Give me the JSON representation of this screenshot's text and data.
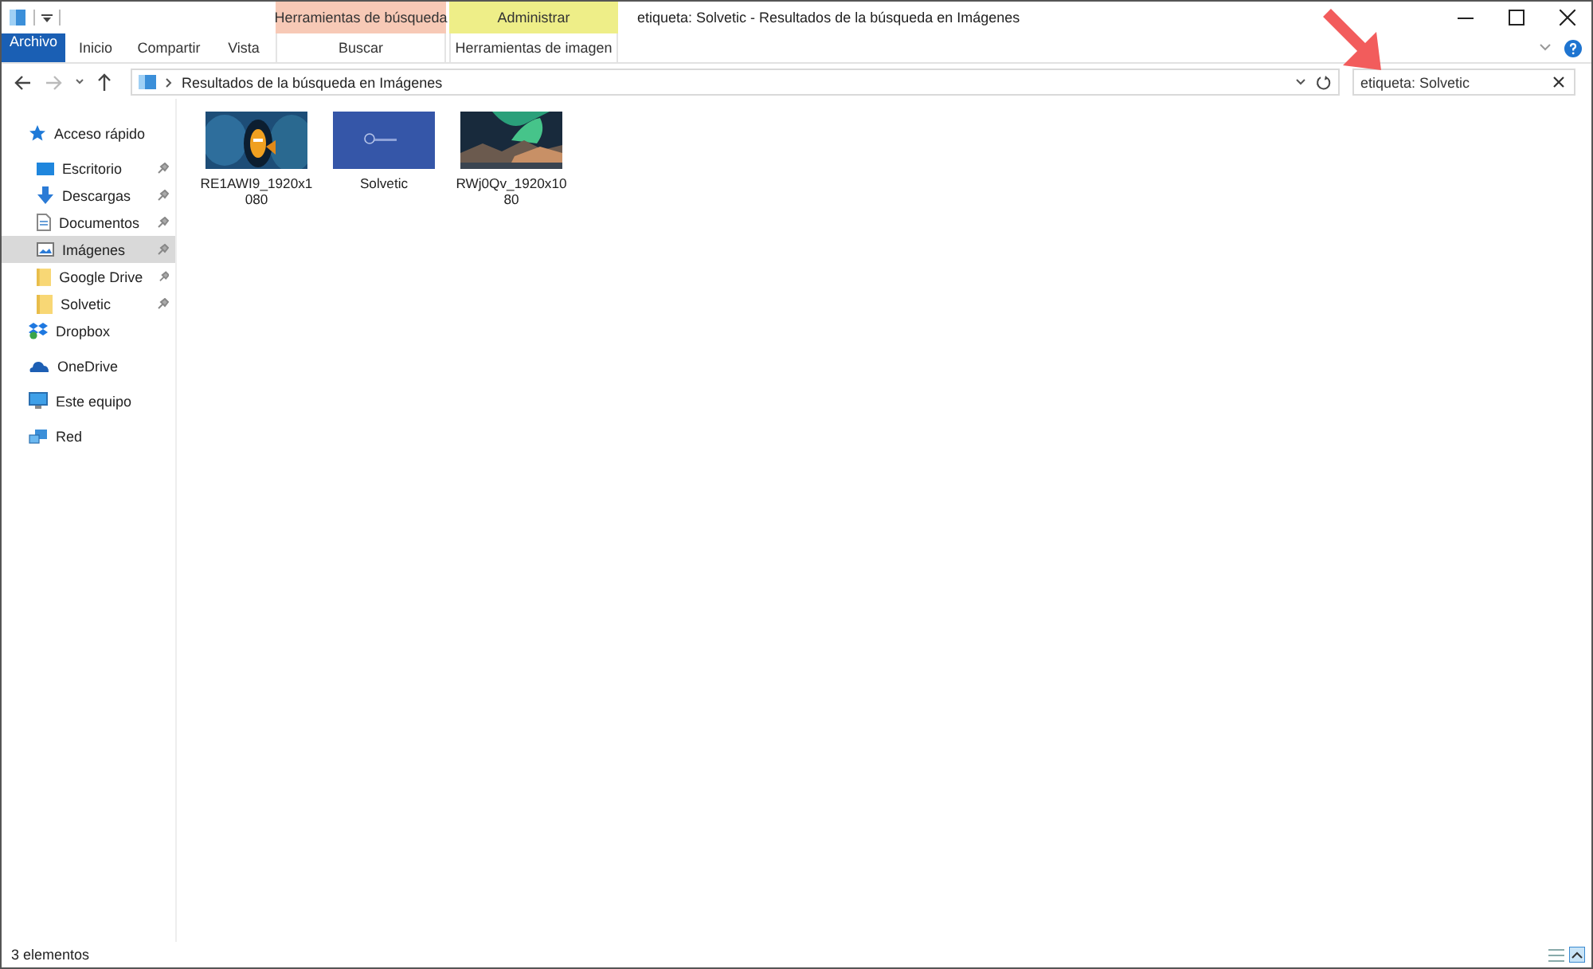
{
  "window": {
    "title": "etiqueta: Solvetic - Resultados de la búsqueda en Imágenes"
  },
  "context_groups": [
    {
      "label": "Herramientas de búsqueda",
      "color": "#f7c9b6"
    },
    {
      "label": "Administrar",
      "color": "#eeee88"
    }
  ],
  "tabs": [
    {
      "label": "Archivo",
      "kind": "file",
      "selected": false
    },
    {
      "label": "Inicio",
      "kind": "normal",
      "selected": false
    },
    {
      "label": "Compartir",
      "kind": "normal",
      "selected": false
    },
    {
      "label": "Vista",
      "kind": "normal",
      "selected": false
    },
    {
      "label": "Buscar",
      "kind": "context",
      "selected": false
    },
    {
      "label": "Herramientas de imagen",
      "kind": "context",
      "selected": false
    }
  ],
  "address": {
    "path": "Resultados de la búsqueda en Imágenes"
  },
  "search": {
    "value": "etiqueta: Solvetic"
  },
  "sidebar": {
    "items": [
      {
        "label": "Acceso rápido",
        "kind": "star",
        "selected": false,
        "children": [
          {
            "label": "Escritorio",
            "kind": "desktop",
            "selected": false,
            "pinned": true
          },
          {
            "label": "Descargas",
            "kind": "download",
            "selected": false,
            "pinned": true
          },
          {
            "label": "Documentos",
            "kind": "document",
            "selected": false,
            "pinned": true
          },
          {
            "label": "Imágenes",
            "kind": "pictures",
            "selected": true,
            "pinned": true
          },
          {
            "label": "Google Drive",
            "kind": "folder",
            "selected": false,
            "pinned": true
          },
          {
            "label": "Solvetic",
            "kind": "folder",
            "selected": false,
            "pinned": true
          }
        ]
      },
      {
        "label": "Dropbox",
        "kind": "dropbox",
        "selected": false
      },
      {
        "label": "OneDrive",
        "kind": "cloud",
        "selected": false
      },
      {
        "label": "Este equipo",
        "kind": "computer",
        "selected": false
      },
      {
        "label": "Red",
        "kind": "network",
        "selected": false
      }
    ]
  },
  "files": [
    {
      "name": "RE1AWI9_1920x1080",
      "kind": "picture"
    },
    {
      "name": "Solvetic",
      "kind": "picture"
    },
    {
      "name": "RWj0Qv_1920x1080",
      "kind": "picture"
    }
  ],
  "status_bar": {
    "count": "3 elementos"
  }
}
